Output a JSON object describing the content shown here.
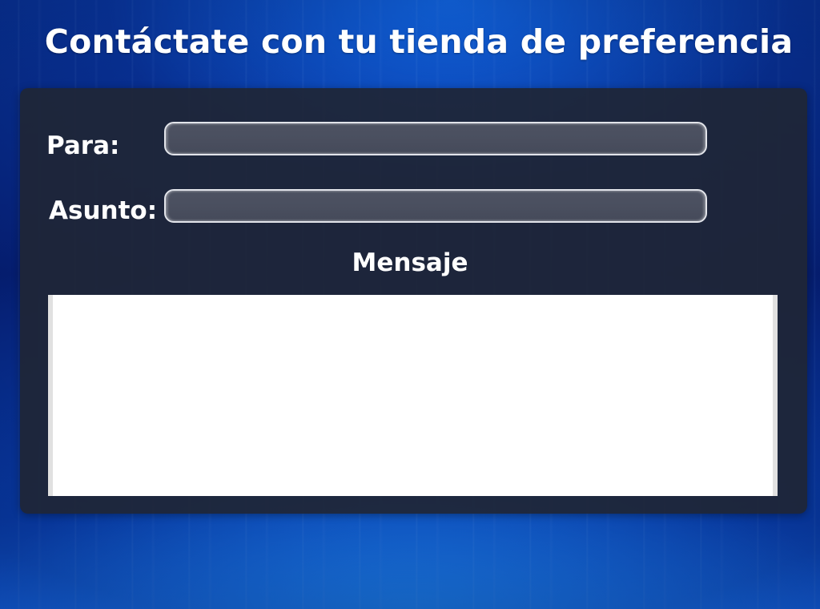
{
  "page": {
    "title": "Contáctate con tu tienda de preferencia"
  },
  "form": {
    "to_label": "Para:",
    "to_value": "",
    "subject_label": "Asunto:",
    "subject_value": "",
    "message_label": "Mensaje",
    "message_value": ""
  },
  "colors": {
    "background": "#0a2a78",
    "panel": "#1f2636",
    "input_fill": "#4a4f5f",
    "input_border": "#e2e4ea",
    "message_fill": "#ffffff",
    "text": "#ffffff"
  }
}
